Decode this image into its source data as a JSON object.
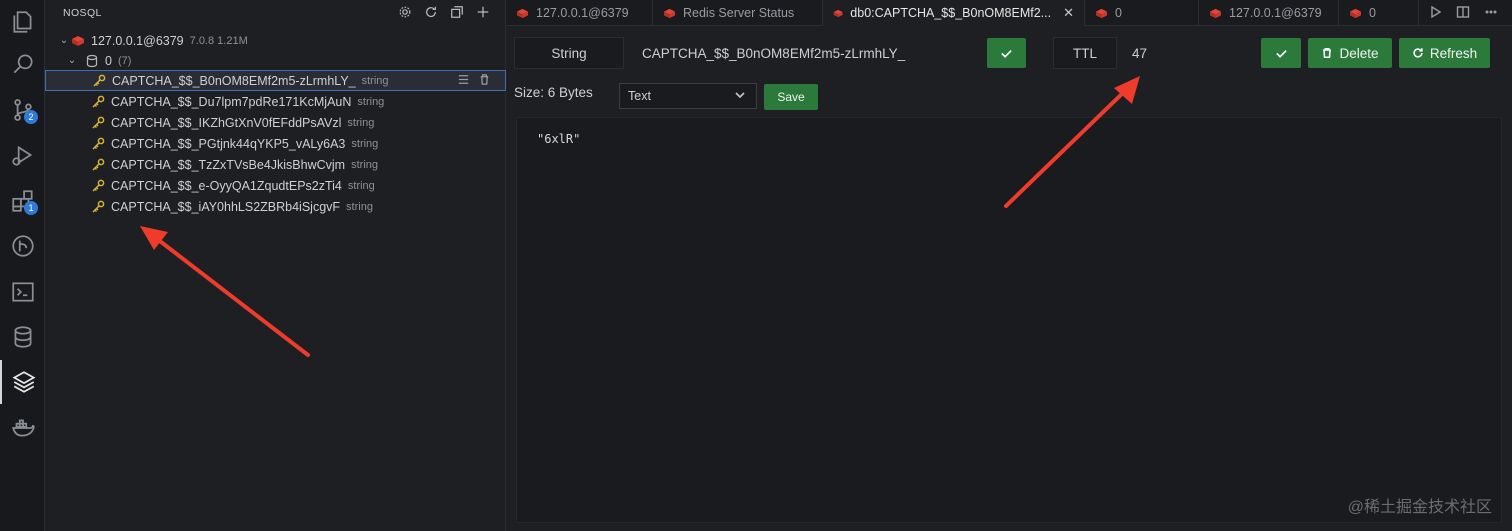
{
  "sidebar": {
    "title": "NOSQL",
    "connection": {
      "name": "127.0.0.1@6379",
      "meta": "7.0.8 1.21M"
    },
    "database": {
      "name": "0",
      "count": "(7)"
    },
    "keys": [
      {
        "name": "CAPTCHA_$$_B0nOM8EMf2m5-zLrmhLY_",
        "type": "string"
      },
      {
        "name": "CAPTCHA_$$_Du7lpm7pdRe171KcMjAuN",
        "type": "string"
      },
      {
        "name": "CAPTCHA_$$_IKZhGtXnV0fEFddPsAVzl",
        "type": "string"
      },
      {
        "name": "CAPTCHA_$$_PGtjnk44qYKP5_vALy6A3",
        "type": "string"
      },
      {
        "name": "CAPTCHA_$$_TzZxTVsBe4JkisBhwCvjm",
        "type": "string"
      },
      {
        "name": "CAPTCHA_$$_e-OyyQA1ZqudtEPs2zTi4",
        "type": "string"
      },
      {
        "name": "CAPTCHA_$$_iAY0hhLS2ZBRb4iSjcgvF",
        "type": "string"
      }
    ]
  },
  "activity": {
    "scm_badge": "2",
    "extensions_badge": "1"
  },
  "tabs": [
    {
      "label": "127.0.0.1@6379"
    },
    {
      "label": "Redis Server Status"
    },
    {
      "label": "db0:CAPTCHA_$$_B0nOM8EMf2..."
    },
    {
      "label": "0"
    },
    {
      "label": "127.0.0.1@6379"
    },
    {
      "label": "0"
    }
  ],
  "editor": {
    "type_label": "String",
    "key_name": "CAPTCHA_$$_B0nOM8EMf2m5-zLrmhLY_",
    "ttl_label": "TTL",
    "ttl_value": "47",
    "delete_label": "Delete",
    "refresh_label": "Refresh",
    "size_label": "Size: 6 Bytes",
    "format_selected": "Text",
    "save_label": "Save",
    "value": "\"6xlR\""
  },
  "watermark": "@稀土掘金技术社区",
  "colors": {
    "accent_green": "#2b7a3b",
    "key_icon": "#d7b23b",
    "redis_red": "#d63b2f",
    "arrow_red": "#ee3b2c"
  }
}
